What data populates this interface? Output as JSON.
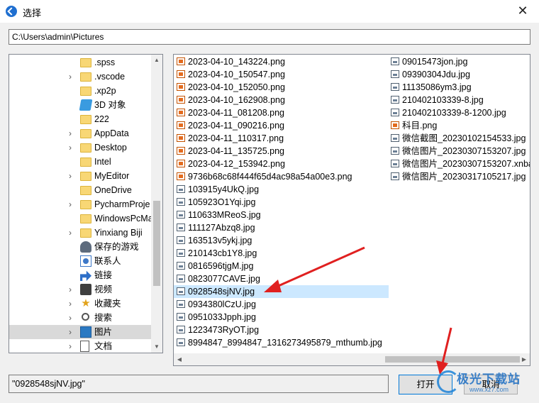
{
  "window": {
    "title": "选择",
    "close_glyph": "✕"
  },
  "path": "C:\\Users\\admin\\Pictures",
  "tree": [
    {
      "label": ".spss",
      "icon": "folder-icon",
      "chevron": false,
      "name": "tree-item-spss"
    },
    {
      "label": ".vscode",
      "icon": "folder-icon",
      "chevron": true,
      "name": "tree-item-vscode"
    },
    {
      "label": ".xp2p",
      "icon": "folder-icon",
      "chevron": false,
      "name": "tree-item-xp2p"
    },
    {
      "label": "3D 对象",
      "icon": "cube-3d-icon",
      "chevron": false,
      "name": "tree-item-3d-objects"
    },
    {
      "label": "222",
      "icon": "folder-icon",
      "chevron": false,
      "name": "tree-item-222"
    },
    {
      "label": "AppData",
      "icon": "folder-icon",
      "chevron": true,
      "name": "tree-item-appdata"
    },
    {
      "label": "Desktop",
      "icon": "folder-icon",
      "chevron": true,
      "name": "tree-item-desktop"
    },
    {
      "label": "Intel",
      "icon": "folder-icon",
      "chevron": false,
      "name": "tree-item-intel"
    },
    {
      "label": "MyEditor",
      "icon": "folder-icon",
      "chevron": true,
      "name": "tree-item-myeditor"
    },
    {
      "label": "OneDrive",
      "icon": "folder-icon",
      "chevron": false,
      "name": "tree-item-onedrive"
    },
    {
      "label": "PycharmProje",
      "icon": "folder-icon",
      "chevron": true,
      "name": "tree-item-pycharmprojects"
    },
    {
      "label": "WindowsPcMa",
      "icon": "folder-icon",
      "chevron": false,
      "name": "tree-item-windowspcmanager"
    },
    {
      "label": "Yinxiang Biji",
      "icon": "folder-icon",
      "chevron": true,
      "name": "tree-item-yinxiang-biji"
    },
    {
      "label": "保存的游戏",
      "icon": "saved-games-icon",
      "chevron": false,
      "name": "tree-item-saved-games"
    },
    {
      "label": "联系人",
      "icon": "contacts-icon",
      "chevron": false,
      "name": "tree-item-contacts"
    },
    {
      "label": "链接",
      "icon": "links-icon",
      "chevron": false,
      "name": "tree-item-links"
    },
    {
      "label": "视频",
      "icon": "video-icon",
      "chevron": true,
      "name": "tree-item-videos"
    },
    {
      "label": "收藏夹",
      "icon": "star-icon",
      "chevron": true,
      "name": "tree-item-favorites"
    },
    {
      "label": "搜索",
      "icon": "search-icon",
      "chevron": true,
      "name": "tree-item-searches"
    },
    {
      "label": "图片",
      "icon": "pictures-icon",
      "chevron": true,
      "name": "tree-item-pictures",
      "selected": true
    },
    {
      "label": "文档",
      "icon": "documents-icon",
      "chevron": true,
      "name": "tree-item-documents"
    }
  ],
  "files_col1": [
    {
      "name": "2023-04-10_143224.png",
      "type": "png"
    },
    {
      "name": "2023-04-10_150547.png",
      "type": "png"
    },
    {
      "name": "2023-04-10_152050.png",
      "type": "png"
    },
    {
      "name": "2023-04-10_162908.png",
      "type": "png"
    },
    {
      "name": "2023-04-11_081208.png",
      "type": "png"
    },
    {
      "name": "2023-04-11_090216.png",
      "type": "png"
    },
    {
      "name": "2023-04-11_110317.png",
      "type": "png"
    },
    {
      "name": "2023-04-11_135725.png",
      "type": "png"
    },
    {
      "name": "2023-04-12_153942.png",
      "type": "png"
    },
    {
      "name": "9736b68c68f444f65d4ac98a54a00e3.png",
      "type": "png"
    },
    {
      "name": "103915y4UkQ.jpg",
      "type": "jpg"
    },
    {
      "name": "105923O1Yqi.jpg",
      "type": "jpg"
    },
    {
      "name": "110633MReoS.jpg",
      "type": "jpg"
    },
    {
      "name": "111127Abzq8.jpg",
      "type": "jpg"
    },
    {
      "name": "163513v5ykj.jpg",
      "type": "jpg"
    },
    {
      "name": "210143cb1Y8.jpg",
      "type": "jpg"
    },
    {
      "name": "0816596tjgM.jpg",
      "type": "jpg"
    },
    {
      "name": "0823077CAVE.jpg",
      "type": "jpg"
    },
    {
      "name": "0928548sjNV.jpg",
      "type": "jpg",
      "selected": true
    },
    {
      "name": "0934380lCzU.jpg",
      "type": "jpg"
    },
    {
      "name": "0951033Jpph.jpg",
      "type": "jpg"
    },
    {
      "name": "1223473RyOT.jpg",
      "type": "jpg"
    },
    {
      "name": "8994847_8994847_1316273495879_mthumb.jpg",
      "type": "jpg"
    }
  ],
  "files_col2": [
    {
      "name": "09015473jon.jpg",
      "type": "jpg"
    },
    {
      "name": "09390304Jdu.jpg",
      "type": "jpg"
    },
    {
      "name": "11135086ym3.jpg",
      "type": "jpg"
    },
    {
      "name": "210402103339-8.jpg",
      "type": "jpg"
    },
    {
      "name": "210402103339-8-1200.jpg",
      "type": "jpg"
    },
    {
      "name": "科目.png",
      "type": "png"
    },
    {
      "name": "微信截图_20230102154533.jpg",
      "type": "jpg"
    },
    {
      "name": "微信图片_20230307153207.jpg",
      "type": "jpg"
    },
    {
      "name": "微信图片_20230307153207.xnba",
      "type": "jpg"
    },
    {
      "name": "微信图片_20230317105217.jpg",
      "type": "jpg"
    }
  ],
  "filename_value": "\"0928548sjNV.jpg\"",
  "buttons": {
    "open": "打开",
    "cancel": "取消"
  },
  "watermark": {
    "title": "极光下载站",
    "subtitle": "www.xz7.com"
  },
  "colors": {
    "selection": "#cce8ff",
    "tree_selection": "#d9d9d9",
    "annotation_arrow": "#e02020",
    "folder": "#f8d775"
  }
}
